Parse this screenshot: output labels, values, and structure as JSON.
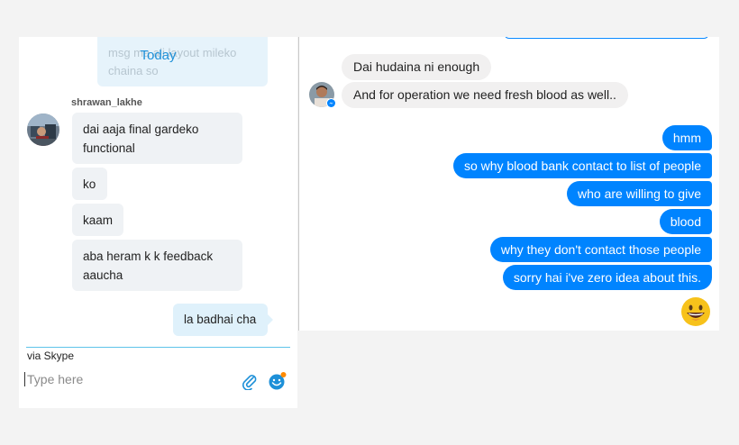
{
  "skype": {
    "previous_message": "msg ma ali layout mileko chaina so",
    "date_divider": "Today",
    "sender_name": "shrawan_lakhe",
    "incoming_messages": [
      "dai aaja final gardeko functional",
      "ko",
      "kaam",
      "aba heram k k feedback aaucha"
    ],
    "outgoing_message": "la badhai cha",
    "via_label": "via Skype",
    "input": {
      "placeholder": "Type here",
      "value": ""
    },
    "accent_color": "#1e90d8"
  },
  "messenger": {
    "received_messages": [
      "Dai hudaina ni enough",
      "And for operation we need fresh blood as well.."
    ],
    "sent_messages": [
      "hmm",
      "so why blood bank contact to list of people",
      "who are willing to give",
      "blood",
      "why they don't contact those people",
      "sorry hai i've zero idea about this."
    ],
    "reaction_emoji": "grinning-face",
    "sent_color": "#0084ff",
    "received_color": "#f1f0f0"
  }
}
